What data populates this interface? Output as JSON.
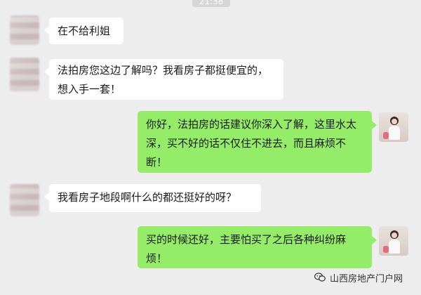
{
  "header": {
    "time_badge": "21:38"
  },
  "messages": [
    {
      "side": "left",
      "text": "在不给利姐"
    },
    {
      "side": "left",
      "text": "法拍房您这边了解吗？我看房子都挺便宜的，想入手一套！"
    },
    {
      "side": "right",
      "text": "你好，法拍房的话建议你深入了解，这里水太深，买不好的话不仅住不进去，而且麻烦不断！"
    },
    {
      "side": "left",
      "text": "我看房子地段啊什么的都还挺好的呀？"
    },
    {
      "side": "right",
      "text": "买的时候还好，主要怕买了之后各种纠纷麻烦！"
    }
  ],
  "watermark": {
    "text": "山西房地产门户网"
  },
  "colors": {
    "background": "#ededed",
    "left_bubble": "#ffffff",
    "right_bubble": "#95ec69"
  }
}
